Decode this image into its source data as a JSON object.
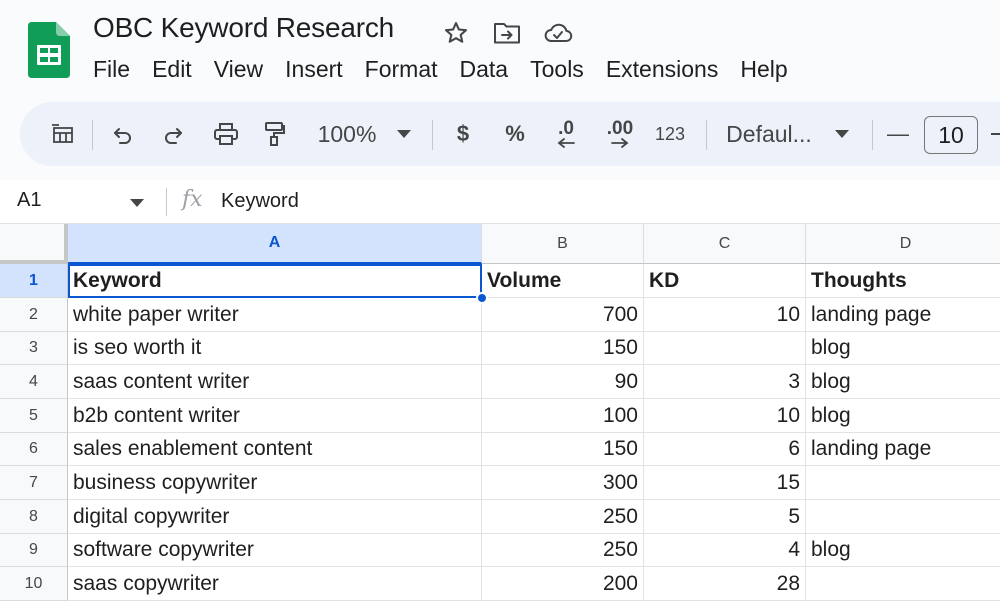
{
  "app": {
    "title": "OBC Keyword Research",
    "title_icons": [
      "star-icon",
      "move-to-folder-icon",
      "cloud-saved-icon"
    ],
    "accent_color": "#0b57d0",
    "logo_color": "#0f9d58"
  },
  "menu": [
    "File",
    "Edit",
    "View",
    "Insert",
    "Format",
    "Data",
    "Tools",
    "Extensions",
    "Help"
  ],
  "toolbar": {
    "zoom": "100%",
    "currency": "$",
    "percent": "%",
    "decrease_decimal": ".0",
    "increase_decimal": ".00",
    "number_format": "123",
    "font": "Defaul...",
    "font_size": "10",
    "minus": "—"
  },
  "formula_bar": {
    "cell_ref": "A1",
    "fx": "fx",
    "content": "Keyword"
  },
  "grid": {
    "columns": [
      "A",
      "B",
      "C",
      "D"
    ],
    "selected_cell": "A1",
    "rows": [
      {
        "num": "1",
        "keyword": "Keyword",
        "volume": "Volume",
        "kd": "KD",
        "thoughts": "Thoughts"
      },
      {
        "num": "2",
        "keyword": "white paper writer",
        "volume": "700",
        "kd": "10",
        "thoughts": "landing page"
      },
      {
        "num": "3",
        "keyword": "is seo worth it",
        "volume": "150",
        "kd": "",
        "thoughts": "blog"
      },
      {
        "num": "4",
        "keyword": "saas content writer",
        "volume": "90",
        "kd": "3",
        "thoughts": "blog"
      },
      {
        "num": "5",
        "keyword": "b2b content writer",
        "volume": "100",
        "kd": "10",
        "thoughts": "blog"
      },
      {
        "num": "6",
        "keyword": "sales enablement content",
        "volume": "150",
        "kd": "6",
        "thoughts": "landing page"
      },
      {
        "num": "7",
        "keyword": "business copywriter",
        "volume": "300",
        "kd": "15",
        "thoughts": ""
      },
      {
        "num": "8",
        "keyword": "digital copywriter",
        "volume": "250",
        "kd": "5",
        "thoughts": ""
      },
      {
        "num": "9",
        "keyword": "software copywriter",
        "volume": "250",
        "kd": "4",
        "thoughts": "blog"
      },
      {
        "num": "10",
        "keyword": "saas copywriter",
        "volume": "200",
        "kd": "28",
        "thoughts": ""
      }
    ]
  }
}
